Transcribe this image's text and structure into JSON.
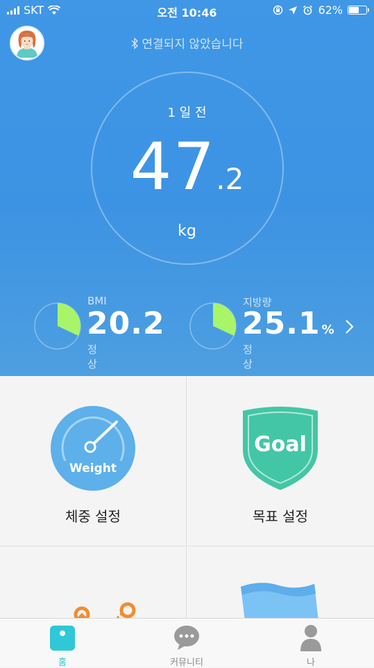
{
  "status_bar": {
    "carrier": "SKT",
    "time": "오전 10:46",
    "battery": "62%",
    "battery_level": 0.62
  },
  "header": {
    "bluetooth_message": "연결되지 않았습니다"
  },
  "measurement": {
    "time_ago": "1 일 전",
    "weight_int": "47",
    "weight_dec": ".2",
    "unit": "kg"
  },
  "metrics": [
    {
      "label": "BMI",
      "value": "20.2",
      "suffix": "",
      "status": "정상",
      "pie_fraction": 0.32
    },
    {
      "label": "지방량",
      "value": "25.1",
      "suffix": "%",
      "status": "정상",
      "pie_fraction": 0.32
    }
  ],
  "tiles": {
    "weight_setting": "체중 설정",
    "goal_setting": "목표 설정",
    "weight_icon_text": "Weight",
    "goal_icon_text": "Goal"
  },
  "tabs": [
    {
      "label": "홈"
    },
    {
      "label": "커뮤니티"
    },
    {
      "label": "나"
    }
  ],
  "colors": {
    "hero_blue": "#3f97e6",
    "pie_green": "#a8f56a",
    "tile_blue": "#5db0ea",
    "shield_green": "#43c6a6",
    "tab_active": "#2ec8d8"
  }
}
